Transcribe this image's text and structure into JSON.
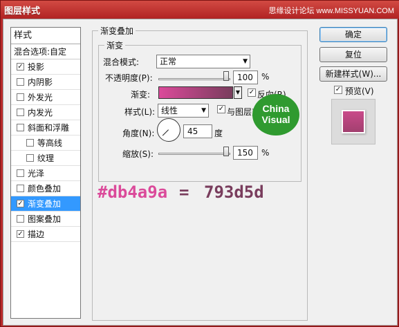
{
  "window": {
    "title": "图层样式",
    "watermark": "思缘设计论坛 www.MISSYUAN.COM"
  },
  "left_panel": {
    "header": "样式",
    "blend_options": "混合选项:自定",
    "items": [
      {
        "label": "投影",
        "checked": true,
        "sub": false,
        "active": false
      },
      {
        "label": "内阴影",
        "checked": false,
        "sub": false,
        "active": false
      },
      {
        "label": "外发光",
        "checked": false,
        "sub": false,
        "active": false
      },
      {
        "label": "内发光",
        "checked": false,
        "sub": false,
        "active": false
      },
      {
        "label": "斜面和浮雕",
        "checked": false,
        "sub": false,
        "active": false
      },
      {
        "label": "等高线",
        "checked": false,
        "sub": true,
        "active": false
      },
      {
        "label": "纹理",
        "checked": false,
        "sub": true,
        "active": false
      },
      {
        "label": "光泽",
        "checked": false,
        "sub": false,
        "active": false
      },
      {
        "label": "颜色叠加",
        "checked": false,
        "sub": false,
        "active": false
      },
      {
        "label": "渐变叠加",
        "checked": true,
        "sub": false,
        "active": true
      },
      {
        "label": "图案叠加",
        "checked": false,
        "sub": false,
        "active": false
      },
      {
        "label": "描边",
        "checked": true,
        "sub": false,
        "active": false
      }
    ]
  },
  "gradient_overlay": {
    "section_title": "渐变叠加",
    "subsection_title": "渐变",
    "blend_mode_label": "混合模式:",
    "blend_mode_value": "正常",
    "opacity_label": "不透明度(P):",
    "opacity_value": "100",
    "opacity_unit": "%",
    "gradient_label": "渐变:",
    "reverse_label": "反向(R)",
    "reverse_checked": true,
    "style_label": "样式(L):",
    "style_value": "线性",
    "align_label": "与图层对",
    "align_checked": true,
    "angle_label": "角度(N):",
    "angle_value": "45",
    "angle_unit": "度",
    "scale_label": "缩放(S):",
    "scale_value": "150",
    "scale_unit": "%",
    "gradient_colors": [
      "#db4a9a",
      "#793d5d"
    ]
  },
  "annotation": {
    "left_text": "#db4a9a",
    "sep": "=",
    "right_text": "793d5d",
    "left_color": "#db4a9a",
    "right_color": "#793d5d"
  },
  "badge": {
    "line1": "China",
    "line2": "Visual"
  },
  "buttons": {
    "ok": "确定",
    "reset": "复位",
    "new_style": "新建样式(W)...",
    "preview_label": "预览(V)",
    "preview_checked": true
  }
}
